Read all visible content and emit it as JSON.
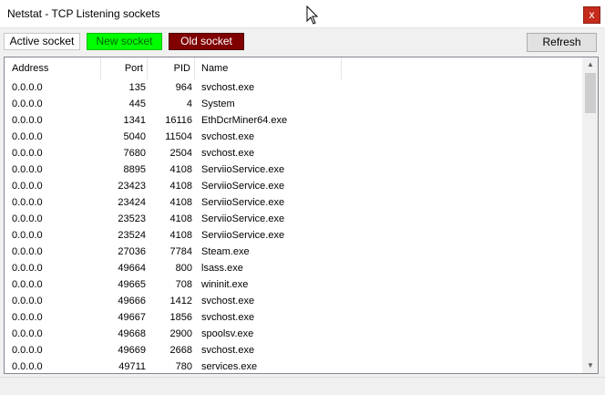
{
  "window": {
    "title": "Netstat - TCP Listening sockets",
    "close_label": "x"
  },
  "toolbar": {
    "active_label": "Active socket",
    "new_label": "New socket",
    "old_label": "Old socket",
    "refresh_label": "Refresh"
  },
  "colors": {
    "new_socket": "#00ff00",
    "old_socket": "#800000",
    "close_button": "#c42b1c"
  },
  "table": {
    "columns": [
      "Address",
      "Port",
      "PID",
      "Name"
    ],
    "rows": [
      [
        "0.0.0.0",
        "135",
        "964",
        "svchost.exe"
      ],
      [
        "0.0.0.0",
        "445",
        "4",
        "System"
      ],
      [
        "0.0.0.0",
        "1341",
        "16116",
        "EthDcrMiner64.exe"
      ],
      [
        "0.0.0.0",
        "5040",
        "11504",
        "svchost.exe"
      ],
      [
        "0.0.0.0",
        "7680",
        "2504",
        "svchost.exe"
      ],
      [
        "0.0.0.0",
        "8895",
        "4108",
        "ServiioService.exe"
      ],
      [
        "0.0.0.0",
        "23423",
        "4108",
        "ServiioService.exe"
      ],
      [
        "0.0.0.0",
        "23424",
        "4108",
        "ServiioService.exe"
      ],
      [
        "0.0.0.0",
        "23523",
        "4108",
        "ServiioService.exe"
      ],
      [
        "0.0.0.0",
        "23524",
        "4108",
        "ServiioService.exe"
      ],
      [
        "0.0.0.0",
        "27036",
        "7784",
        "Steam.exe"
      ],
      [
        "0.0.0.0",
        "49664",
        "800",
        "lsass.exe"
      ],
      [
        "0.0.0.0",
        "49665",
        "708",
        "wininit.exe"
      ],
      [
        "0.0.0.0",
        "49666",
        "1412",
        "svchost.exe"
      ],
      [
        "0.0.0.0",
        "49667",
        "1856",
        "svchost.exe"
      ],
      [
        "0.0.0.0",
        "49668",
        "2900",
        "spoolsv.exe"
      ],
      [
        "0.0.0.0",
        "49669",
        "2668",
        "svchost.exe"
      ],
      [
        "0.0.0.0",
        "49711",
        "780",
        "services.exe"
      ]
    ]
  },
  "icons": {
    "scroll_up": "chevron-up-icon",
    "scroll_down": "chevron-down-icon",
    "cursor": "mouse-cursor-icon"
  }
}
